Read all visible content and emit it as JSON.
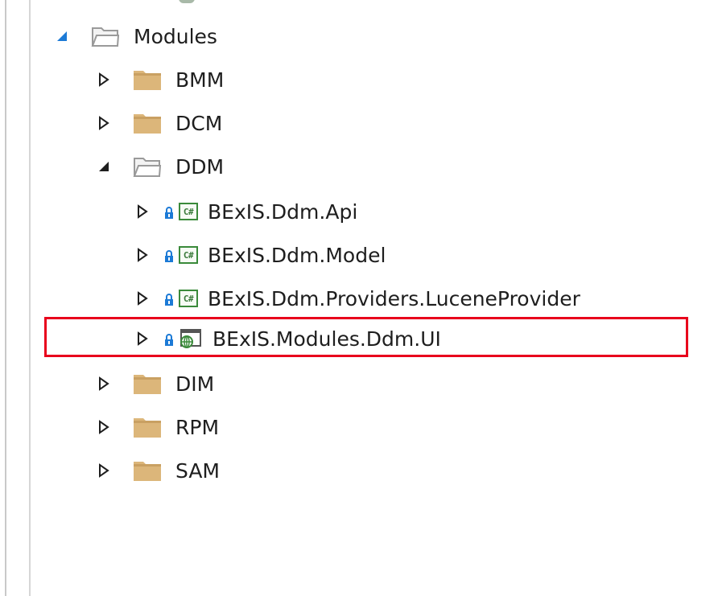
{
  "tree": {
    "modules": {
      "label": "Modules",
      "toggle_icon": "expanded-arrow",
      "folder_icon": "open-folder"
    },
    "bmm": {
      "label": "BMM",
      "toggle_icon": "collapsed-arrow",
      "folder_icon": "closed-folder"
    },
    "dcm": {
      "label": "DCM",
      "toggle_icon": "collapsed-arrow",
      "folder_icon": "closed-folder"
    },
    "ddm": {
      "label": "DDM",
      "toggle_icon": "expanded-arrow",
      "folder_icon": "open-folder"
    },
    "ddm_api": {
      "label": "BExIS.Ddm.Api",
      "icon": "csharp-project-icon",
      "lock_icon": "lock-icon"
    },
    "ddm_model": {
      "label": "BExIS.Ddm.Model",
      "icon": "csharp-project-icon",
      "lock_icon": "lock-icon"
    },
    "ddm_lucene": {
      "label": "BExIS.Ddm.Providers.LuceneProvider",
      "icon": "csharp-project-icon",
      "lock_icon": "lock-icon"
    },
    "ddm_ui": {
      "label": "BExIS.Modules.Ddm.UI",
      "icon": "web-project-icon",
      "lock_icon": "lock-icon",
      "highlighted": true
    },
    "dim": {
      "label": "DIM",
      "toggle_icon": "collapsed-arrow",
      "folder_icon": "closed-folder"
    },
    "rpm": {
      "label": "RPM",
      "toggle_icon": "collapsed-arrow",
      "folder_icon": "closed-folder"
    },
    "sam": {
      "label": "SAM",
      "toggle_icon": "collapsed-arrow",
      "folder_icon": "closed-folder"
    }
  },
  "cs_badge": "C#",
  "colors": {
    "expanded_arrow": "#1e1e1e",
    "modules_arrow": "#1c7ad6",
    "folder_fill": "#dcb67a",
    "folder_tab": "#c9a062",
    "csharp_green": "#3a8a3a",
    "lock_blue": "#1c7ad6",
    "highlight_red": "#e8001c"
  }
}
